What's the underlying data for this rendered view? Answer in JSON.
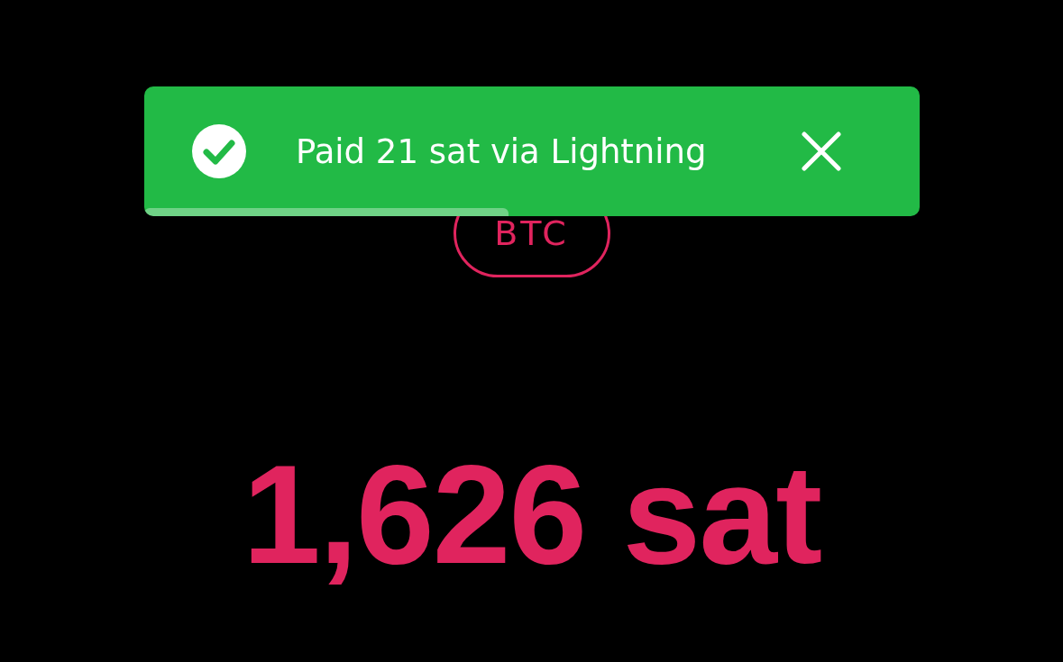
{
  "toast": {
    "kind": "success",
    "message": "Paid 21 sat via Lightning",
    "level": 0.47
  },
  "currency": {
    "label": "BTC"
  },
  "balance": {
    "amount": "1,626 sat"
  }
}
